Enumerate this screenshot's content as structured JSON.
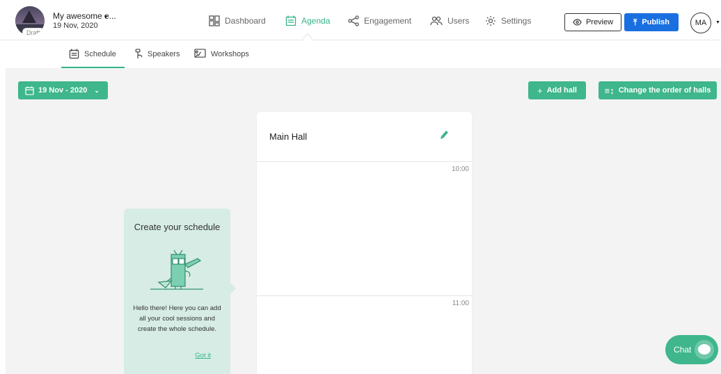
{
  "event": {
    "name": "My awesome e...",
    "date": "19 Nov, 2020",
    "badge": "Draft"
  },
  "nav": {
    "dashboard": "Dashboard",
    "agenda": "Agenda",
    "engagement": "Engagement",
    "users": "Users",
    "settings": "Settings"
  },
  "actions": {
    "preview": "Preview",
    "publish": "Publish",
    "avatar": "MA"
  },
  "subnav": {
    "schedule": "Schedule",
    "speakers": "Speakers",
    "workshops": "Workshops"
  },
  "toolbar": {
    "date": "19 Nov - 2020",
    "add_hall": "Add hall",
    "reorder": "Change the order of halls"
  },
  "hall": {
    "title": "Main Hall",
    "times": [
      "10:00",
      "11:00"
    ]
  },
  "onboarding": {
    "title": "Create your schedule",
    "text": "Hello there! Here you can add all your cool sessions and create the whole schedule.",
    "dismiss": "Got it"
  },
  "chat": {
    "label": "Chat"
  },
  "colors": {
    "accent": "#3fb68c",
    "publish": "#1a6fe0"
  }
}
